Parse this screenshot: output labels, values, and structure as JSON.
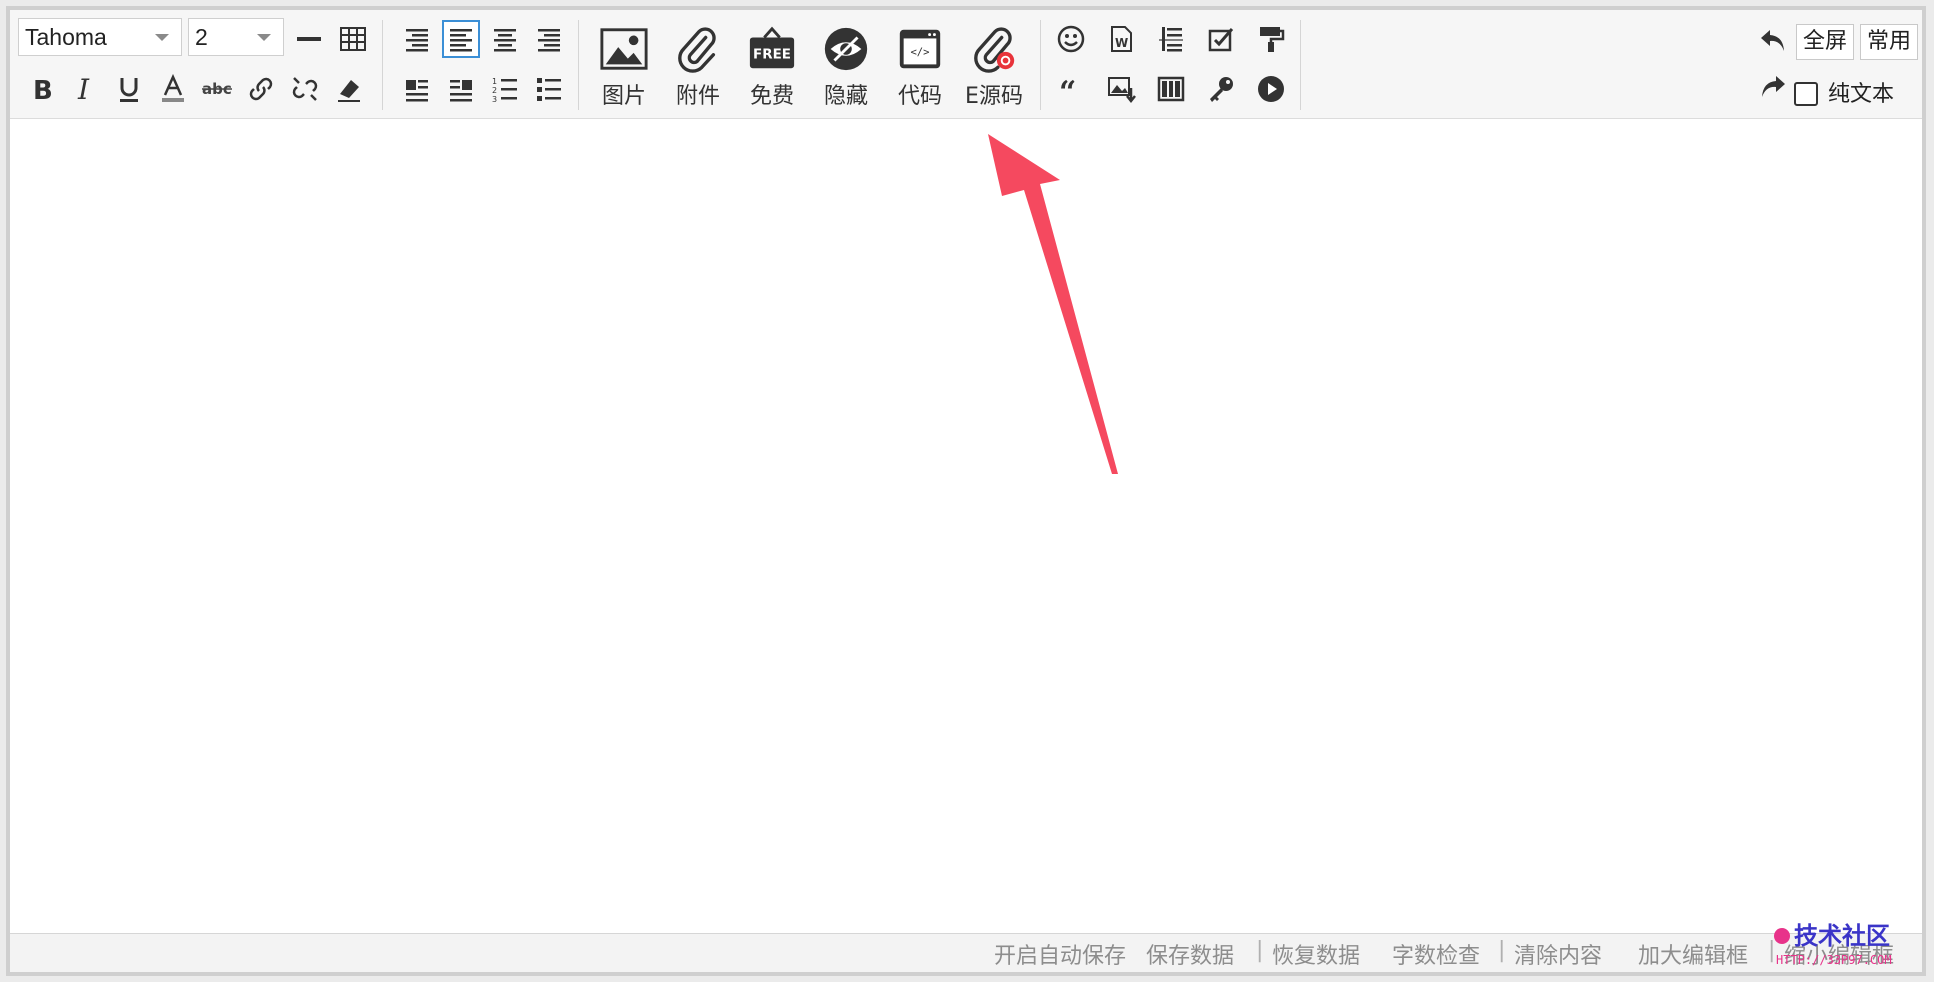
{
  "font_select": {
    "value": "Tahoma"
  },
  "size_select": {
    "value": "2"
  },
  "insert_buttons": [
    {
      "label": "图片",
      "icon": "image-icon"
    },
    {
      "label": "附件",
      "icon": "paperclip-icon"
    },
    {
      "label": "免费",
      "icon": "free-sign-icon",
      "badge": "FREE"
    },
    {
      "label": "隐藏",
      "icon": "hidden-eye-icon"
    },
    {
      "label": "代码",
      "icon": "code-window-icon"
    },
    {
      "label": "E源码",
      "icon": "esource-icon"
    }
  ],
  "right": {
    "fullscreen_label": "全屏",
    "common_label": "常用",
    "plaintext_label": "纯文本"
  },
  "status": {
    "autosave": "开启自动保存",
    "save": "保存数据",
    "restore": "恢复数据",
    "wordcount": "字数检查",
    "clear": "清除内容",
    "enlarge": "加大编辑框",
    "shrink": "缩小编辑框",
    "separator": "|"
  },
  "watermark": {
    "title": "技术社区",
    "url": "HTTP://33P97.COM"
  },
  "colors": {
    "arrow": "#f5495f",
    "active_border": "#3b8fd6",
    "esource_accent": "#e8333a",
    "status_text": "#8d8d8d"
  }
}
